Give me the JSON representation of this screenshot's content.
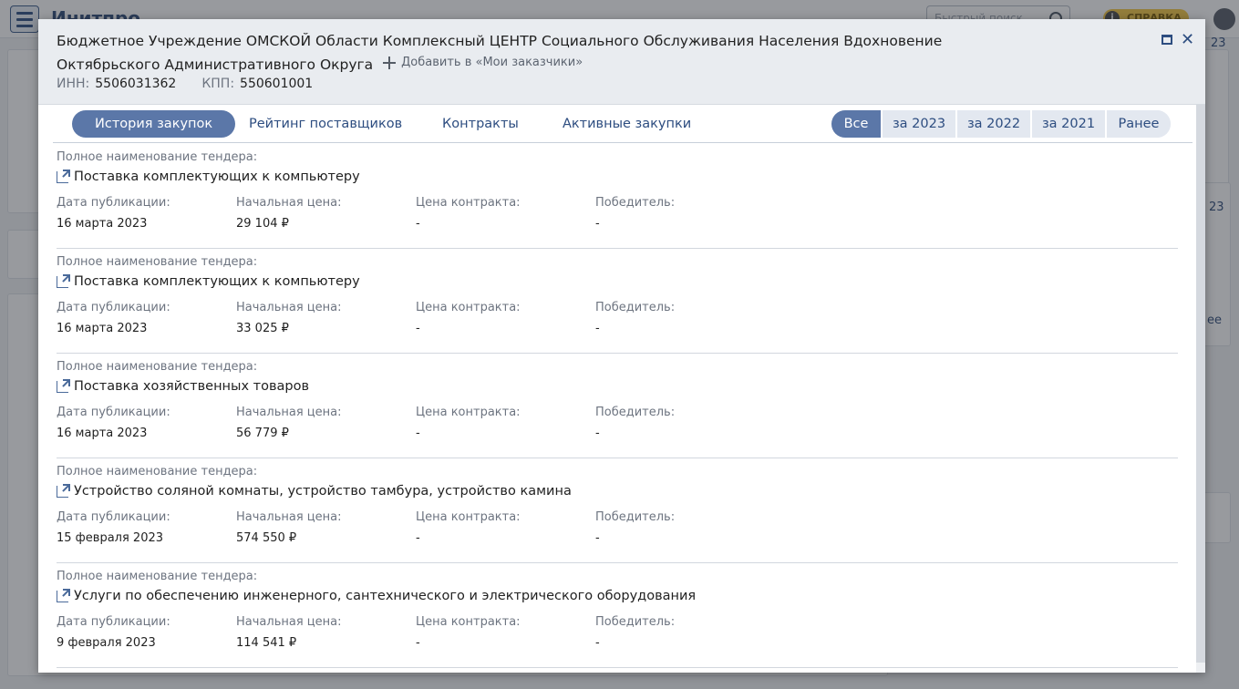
{
  "background": {
    "app_title": "Инитпро",
    "search_placeholder": "Быстрый поиск",
    "help_label": "СПРАВКА",
    "side_fragments": [
      "23",
      "23",
      "ее"
    ]
  },
  "modal": {
    "org_name": "Бюджетное Учреждение ОМСКОЙ Области Комплексный ЦЕНТР Социального Обслуживания Населения Вдохновение Октябрьского Административного Округа",
    "add_label": "Добавить в «Мои заказчики»",
    "inn_label": "ИНН:",
    "inn_value": "5506031362",
    "kpp_label": "КПП:",
    "kpp_value": "550601001"
  },
  "tabs": [
    {
      "label": "История закупок",
      "active": true
    },
    {
      "label": "Рейтинг поставщиков",
      "active": false
    },
    {
      "label": "Контракты",
      "active": false
    },
    {
      "label": "Активные закупки",
      "active": false
    }
  ],
  "periods": [
    {
      "label": "Все",
      "active": true
    },
    {
      "label": "за 2023",
      "active": false
    },
    {
      "label": "за 2022",
      "active": false
    },
    {
      "label": "за 2021",
      "active": false
    },
    {
      "label": "Ранее",
      "active": false
    }
  ],
  "labels": {
    "tender_name": "Полное наименование тендера:",
    "pub_date": "Дата публикации:",
    "start_price": "Начальная цена:",
    "contract_price": "Цена контракта:",
    "winner": "Победитель:"
  },
  "items": [
    {
      "name": "Поставка комплектующих к компьютеру",
      "date": "16 марта 2023",
      "price": "29 104 ₽",
      "contract_price": "-",
      "winner": "-"
    },
    {
      "name": "Поставка комплектующих к компьютеру",
      "date": "16 марта 2023",
      "price": "33 025 ₽",
      "contract_price": "-",
      "winner": "-"
    },
    {
      "name": "Поставка хозяйственных товаров",
      "date": "16 марта 2023",
      "price": "56 779 ₽",
      "contract_price": "-",
      "winner": "-"
    },
    {
      "name": "Устройство соляной комнаты, устройство тамбура, устройство камина",
      "date": "15 февраля 2023",
      "price": "574 550 ₽",
      "contract_price": "-",
      "winner": "-"
    },
    {
      "name": "Услуги по обеспечению инженерного, сантехнического и электрического оборудования",
      "date": "9 февраля 2023",
      "price": "114 541 ₽",
      "contract_price": "-",
      "winner": "-"
    }
  ],
  "colors": {
    "accent": "#5b77a8",
    "link": "#2d4d80",
    "header_bg": "#e9ecf0"
  }
}
